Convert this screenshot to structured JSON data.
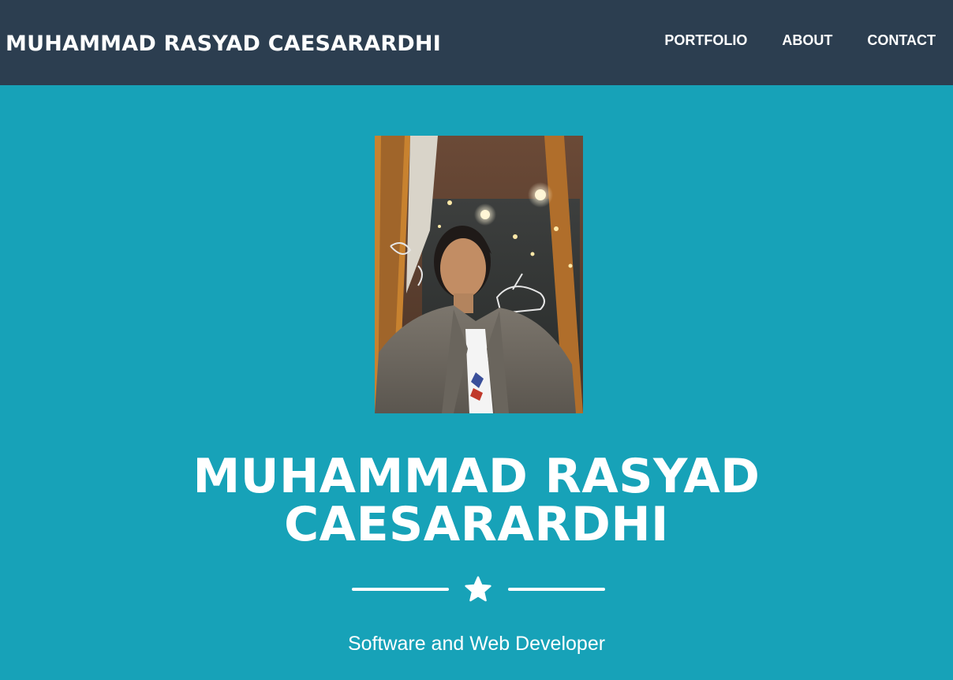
{
  "navbar": {
    "brand": "MUHAMMAD RASYAD CAESARARDHI",
    "links": [
      {
        "label": "PORTFOLIO"
      },
      {
        "label": "ABOUT"
      },
      {
        "label": "CONTACT"
      }
    ],
    "background": "#2c3e50"
  },
  "masthead": {
    "background": "#17a2b8",
    "avatar_alt": "profile photo",
    "heading_line1": "MUHAMMAD RASYAD",
    "heading_line2": "CAESARARDHI",
    "divider_icon": "star-icon",
    "subheading": "Software and Web Developer"
  }
}
